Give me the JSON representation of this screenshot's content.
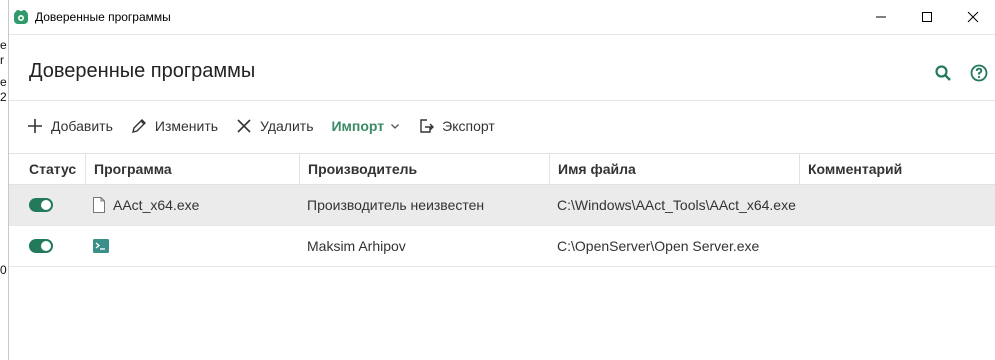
{
  "window": {
    "title": "Доверенные программы"
  },
  "header": {
    "title": "Доверенные программы"
  },
  "toolbar": {
    "add": "Добавить",
    "edit": "Изменить",
    "delete": "Удалить",
    "import": "Импорт",
    "export": "Экспорт"
  },
  "table": {
    "columns": [
      "Статус",
      "Программа",
      "Производитель",
      "Имя файла",
      "Комментарий"
    ],
    "rows": [
      {
        "status": "on",
        "program": "AAct_x64.exe",
        "vendor": "Производитель неизвестен",
        "file": "C:\\Windows\\AAct_Tools\\AAct_x64.exe",
        "comment": ""
      },
      {
        "status": "on",
        "program": "",
        "vendor": "Maksim Arhipov",
        "file": "C:\\OpenServer\\Open Server.exe",
        "comment": ""
      }
    ]
  },
  "background": {
    "chars": [
      "e",
      "r",
      "e",
      "2",
      "0"
    ]
  },
  "colors": {
    "accent": "#227a5a",
    "import_text": "#3b8a68",
    "selected_row": "#ebebeb"
  },
  "icons": [
    "app-logo-icon",
    "minimize-icon",
    "maximize-icon",
    "close-icon",
    "search-icon",
    "help-icon",
    "plus-icon",
    "pencil-icon",
    "x-icon",
    "chevron-down-icon",
    "export-icon",
    "file-icon",
    "terminal-icon"
  ]
}
